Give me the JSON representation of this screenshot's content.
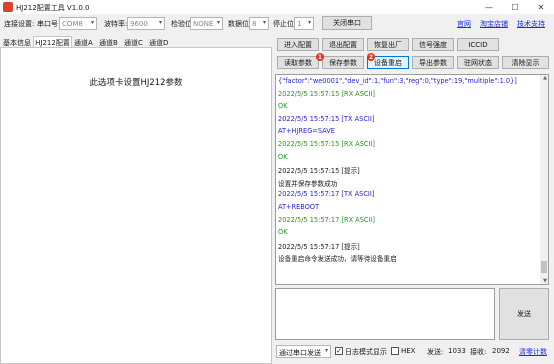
{
  "window": {
    "title": "HJ212配置工具 V1.0.0",
    "minimize": "—",
    "maximize": "☐",
    "close": "✕"
  },
  "toolbar": {
    "conn_label": "连接设置:",
    "port_label": "串口号",
    "port_value": "COM8",
    "baud_label": "波特率:",
    "baud_value": "9600",
    "parity_label": "检验位",
    "parity_value": "NONE",
    "databits_label": "数据位",
    "databits_value": "8",
    "stopbits_label": "停止位",
    "stopbits_value": "1",
    "close_port": "关闭串口",
    "links": [
      "官网",
      "淘宝店铺",
      "技术支持"
    ]
  },
  "tabs": [
    "基本信息",
    "HJ212配置",
    "通道A",
    "通道B",
    "通道C",
    "通道D"
  ],
  "active_tab": "HJ212配置",
  "tab_description": "此选项卡设置HJ212参数",
  "actions_row1": [
    "进入配置",
    "退出配置",
    "恢复出厂",
    "信号强度",
    "ICCID"
  ],
  "actions_row2": [
    "读取参数",
    "保存参数",
    "设备重启",
    "导出参数",
    "驻网状态",
    "清除显示"
  ],
  "badges": [
    "1",
    "2"
  ],
  "log": [
    {
      "text": "{\"factor\":\"we0001\",\"dev_id\":1,\"fun\":3,\"reg\":0,\"type\":19,\"multiple\":1.0}]",
      "kind": "tx"
    },
    {
      "text": "2022/5/5 15:57:15 [RX ASCII]",
      "kind": "rx"
    },
    {
      "text": "OK",
      "kind": "rx"
    },
    {
      "text": "2022/5/5 15:57:15 [TX ASCII]",
      "kind": "tx"
    },
    {
      "text": "AT+HJREG=SAVE",
      "kind": "tx"
    },
    {
      "text": "2022/5/5 15:57:15 [RX ASCII]",
      "kind": "rx"
    },
    {
      "text": "OK",
      "kind": "rx"
    },
    {
      "text": "2022/5/5 15:57:15 [提示]",
      "kind": "info"
    },
    {
      "text": "设置并保存参数成功",
      "kind": "info"
    },
    {
      "text": "2022/5/5 15:57:17 [TX ASCII]",
      "kind": "tx"
    },
    {
      "text": "AT+REBOOT",
      "kind": "tx"
    },
    {
      "text": "2022/5/5 15:57:17 [RX ASCII]",
      "kind": "rx"
    },
    {
      "text": "OK",
      "kind": "rx"
    },
    {
      "text": "2022/5/5 15:57:17 [提示]",
      "kind": "info"
    },
    {
      "text": "设备重启命令发送成功，请等待设备重启",
      "kind": "info"
    }
  ],
  "log_colors": {
    "tx": "#2424d8",
    "rx": "#1f9a1f",
    "info": "#1a1a1a"
  },
  "send_button": "发送",
  "status": {
    "send_mode": "通过串口发送",
    "log_mode": "日志模式显示",
    "log_mode_checked": true,
    "hex_label": "HEX",
    "hex_checked": false,
    "sent_label": "发送:",
    "sent_value": "1033",
    "recv_label": "接收:",
    "recv_value": "2092",
    "clear_count": "清零计数"
  }
}
